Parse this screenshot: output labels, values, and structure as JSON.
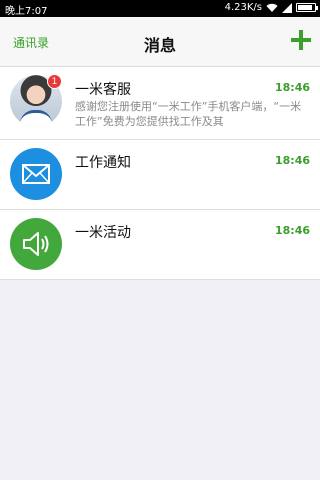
{
  "status_bar": {
    "time": "晚上7:07",
    "speed": "4.23K/s"
  },
  "header": {
    "contacts_label": "通讯录",
    "title": "消息"
  },
  "messages": [
    {
      "name": "一米客服",
      "time": "18:46",
      "preview": "感谢您注册使用“一米工作”手机客户端，“一米工作”免费为您提供找工作及其",
      "badge": "1",
      "icon": "customer-service-avatar"
    },
    {
      "name": "工作通知",
      "time": "18:46",
      "icon": "mail-icon"
    },
    {
      "name": "一米活动",
      "time": "18:46",
      "icon": "speaker-icon"
    }
  ],
  "colors": {
    "accent": "#3a9f2b",
    "badge": "#e8393a",
    "mail": "#1d8fe0",
    "speaker": "#43a83c"
  }
}
